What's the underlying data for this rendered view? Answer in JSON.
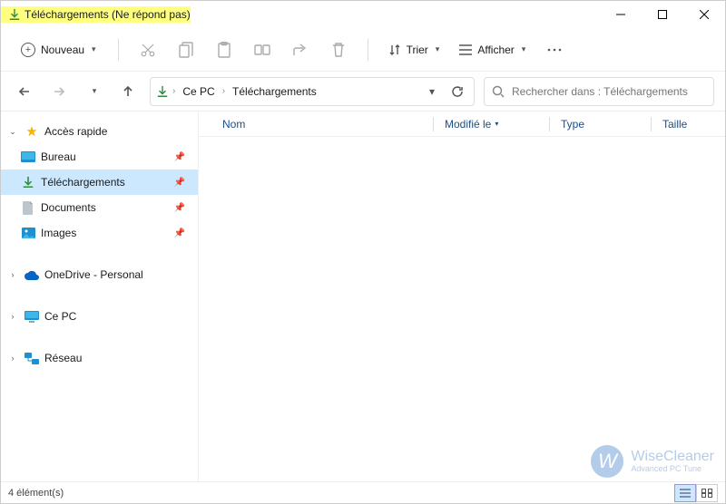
{
  "window": {
    "title": "Téléchargements (Ne répond pas)"
  },
  "toolbar": {
    "new_label": "Nouveau",
    "sort_label": "Trier",
    "view_label": "Afficher"
  },
  "breadcrumb": {
    "root": "Ce PC",
    "current": "Téléchargements"
  },
  "search": {
    "placeholder": "Rechercher dans : Téléchargements"
  },
  "sidebar": {
    "quick_access": "Accès rapide",
    "items": [
      {
        "label": "Bureau"
      },
      {
        "label": "Téléchargements"
      },
      {
        "label": "Documents"
      },
      {
        "label": "Images"
      }
    ],
    "onedrive": "OneDrive - Personal",
    "this_pc": "Ce PC",
    "network": "Réseau"
  },
  "columns": {
    "name": "Nom",
    "modified": "Modifié le",
    "type": "Type",
    "size": "Taille"
  },
  "status": {
    "count_text": "4 élément(s)"
  },
  "watermark": {
    "brand": "WiseCleaner",
    "tagline": "Advanced PC Tune"
  },
  "colors": {
    "selection": "#cce8ff",
    "highlight_title": "#ffff80",
    "link": "#1a4e8a"
  }
}
